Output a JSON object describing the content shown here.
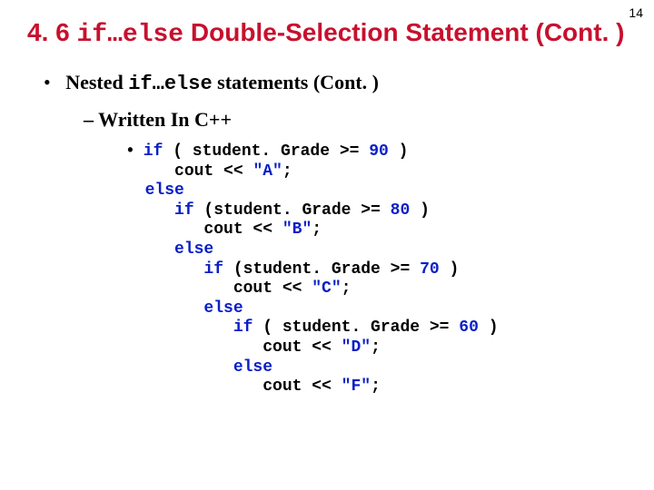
{
  "page_number": "14",
  "title": {
    "prefix": "4. 6 ",
    "mono": "if…else",
    "suffix": " Double-Selection Statement (Cont. )"
  },
  "bullet1": {
    "prefix": "Nested ",
    "mono": "if…else",
    "suffix": " statements (Cont. )"
  },
  "bullet2": "Written In C++",
  "code": {
    "l01a": "if",
    "l01b": " ( student. Grade >= ",
    "l01c": "90",
    "l01d": " )",
    "l02a": "   cout << ",
    "l02b": "\"A\"",
    "l02c": ";",
    "l03a": "else",
    "l04a": "   ",
    "l04b": "if",
    "l04c": " (student. Grade >= ",
    "l04d": "80",
    "l04e": " )",
    "l05a": "      cout << ",
    "l05b": "\"B\"",
    "l05c": ";",
    "l06a": "   ",
    "l06b": "else",
    "l07a": "      ",
    "l07b": "if",
    "l07c": " (student. Grade >= ",
    "l07d": "70",
    "l07e": " )",
    "l08a": "         cout << ",
    "l08b": "\"C\"",
    "l08c": ";",
    "l09a": "      ",
    "l09b": "else",
    "l10a": "         ",
    "l10b": "if",
    "l10c": " ( student. Grade >= ",
    "l10d": "60",
    "l10e": " )",
    "l11a": "            cout << ",
    "l11b": "\"D\"",
    "l11c": ";",
    "l12a": "         ",
    "l12b": "else",
    "l13a": "            cout << ",
    "l13b": "\"F\"",
    "l13c": ";"
  }
}
